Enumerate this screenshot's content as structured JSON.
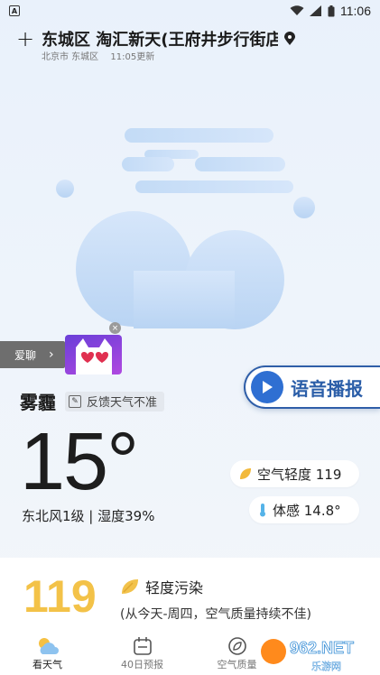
{
  "status_bar": {
    "time": "11:06",
    "left_icon": "A"
  },
  "header": {
    "location": "东城区 淘汇新天(王府井步行街店",
    "city": "北京市 东城区",
    "updated": "11:05更新"
  },
  "ad": {
    "label": "爱聊",
    "arrow": "›",
    "close": "×"
  },
  "voice": {
    "label": "语音播报"
  },
  "weather": {
    "condition": "雾霾",
    "feedback": "反馈天气不准",
    "temperature": "15°",
    "wind_humidity": "东北风1级 | 湿度39%",
    "aqi_chip": "空气轻度 119",
    "feels_like": "体感 14.8°"
  },
  "air": {
    "aqi": "119",
    "level": "轻度污染",
    "description": "(从今天-周四，空气质量持续不佳)"
  },
  "tabs": [
    {
      "label": "看天气",
      "icon": "weather-icon",
      "active": true
    },
    {
      "label": "40日预报",
      "icon": "calendar-icon",
      "active": false
    },
    {
      "label": "空气质量",
      "icon": "air-quality-icon",
      "active": false
    }
  ],
  "watermark": "962.NET 乐游网",
  "colors": {
    "accent": "#2f6fd2",
    "aqi": "#f3c248"
  }
}
